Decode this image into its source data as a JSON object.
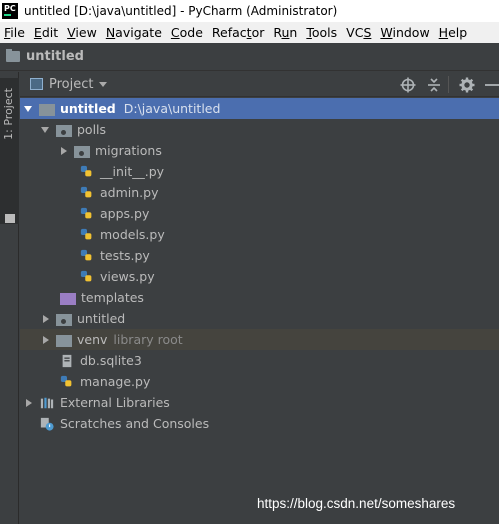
{
  "window": {
    "title": "untitled [D:\\java\\untitled] - PyCharm (Administrator)"
  },
  "menu": [
    {
      "pre": "",
      "u": "F",
      "post": "ile"
    },
    {
      "pre": "",
      "u": "E",
      "post": "dit"
    },
    {
      "pre": "",
      "u": "V",
      "post": "iew"
    },
    {
      "pre": "",
      "u": "N",
      "post": "avigate"
    },
    {
      "pre": "",
      "u": "C",
      "post": "ode"
    },
    {
      "pre": "Refac",
      "u": "t",
      "post": "or"
    },
    {
      "pre": "R",
      "u": "u",
      "post": "n"
    },
    {
      "pre": "",
      "u": "T",
      "post": "ools"
    },
    {
      "pre": "VC",
      "u": "S",
      "post": ""
    },
    {
      "pre": "",
      "u": "W",
      "post": "indow"
    },
    {
      "pre": "",
      "u": "H",
      "post": "elp"
    }
  ],
  "navbar": {
    "label": "untitled"
  },
  "left_strip": {
    "tab_label": "1: Project"
  },
  "panel": {
    "title": "Project"
  },
  "tree": {
    "root": {
      "label": "untitled",
      "path": "D:\\java\\untitled"
    },
    "polls": "polls",
    "migrations": "migrations",
    "init": "__init__.py",
    "admin": "admin.py",
    "apps": "apps.py",
    "models": "models.py",
    "tests": "tests.py",
    "views": "views.py",
    "templates": "templates",
    "untitled_pkg": "untitled",
    "venv": {
      "label": "venv",
      "hint": "library root"
    },
    "db": "db.sqlite3",
    "manage": "manage.py",
    "external": "External Libraries",
    "scratches": "Scratches and Consoles"
  },
  "watermark": "https://blog.csdn.net/someshares",
  "colors": {
    "selection": "#4b6eaf",
    "venv_highlight": "#45443e",
    "background": "#3c3f41",
    "templates_folder": "#9a7ec4"
  },
  "icons": {
    "locate": "crosshair-icon",
    "collapse": "collapse-all-icon",
    "settings": "gear-icon",
    "hide": "hide-panel-icon"
  }
}
